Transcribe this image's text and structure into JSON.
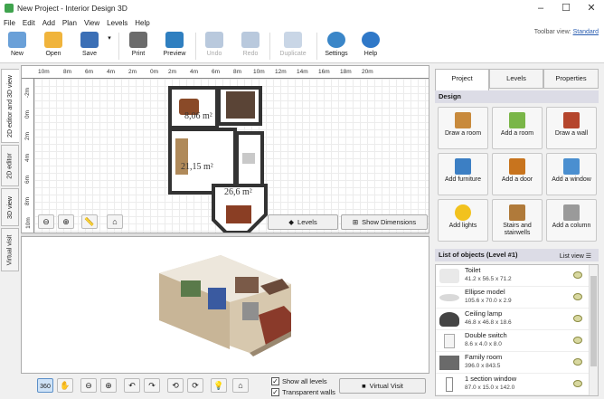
{
  "window": {
    "title": "New Project - Interior Design 3D",
    "minimize": "–",
    "maximize": "☐",
    "close": "✕"
  },
  "menu": [
    "File",
    "Edit",
    "Add",
    "Plan",
    "View",
    "Levels",
    "Help"
  ],
  "toolbar": {
    "buttons": [
      {
        "label": "New",
        "icon": "new-document-icon",
        "color": "#6aa0d8"
      },
      {
        "label": "Open",
        "icon": "open-folder-icon",
        "color": "#f0b43c"
      },
      {
        "label": "Save",
        "icon": "floppy-disk-icon",
        "color": "#3b6fb6"
      },
      {
        "label": "Print",
        "icon": "printer-icon",
        "color": "#6b6b6b"
      },
      {
        "label": "Preview",
        "icon": "monitor-icon",
        "color": "#2f7fc0"
      },
      {
        "label": "Undo",
        "icon": "undo-icon",
        "color": "#b9c9dd"
      },
      {
        "label": "Redo",
        "icon": "redo-icon",
        "color": "#b9c9dd"
      },
      {
        "label": "Duplicate",
        "icon": "duplicate-icon",
        "color": "#c9d6e6"
      },
      {
        "label": "Settings",
        "icon": "gear-icon",
        "color": "#3a86c8"
      },
      {
        "label": "Help",
        "icon": "help-icon",
        "color": "#2f78c8"
      }
    ],
    "view_label": "Toolbar view:",
    "view_value": "Standard"
  },
  "side_tabs": [
    "2D editor and 3D view",
    "2D editor",
    "3D view",
    "Virtual visit"
  ],
  "ruler": {
    "h": [
      "10m",
      "8m",
      "6m",
      "4m",
      "2m",
      "0m",
      "2m",
      "4m",
      "6m",
      "8m",
      "10m",
      "12m",
      "14m",
      "16m",
      "18m",
      "20m"
    ],
    "v": [
      "-2m",
      "0m",
      "2m",
      "4m",
      "6m",
      "8m",
      "10m"
    ]
  },
  "plan": {
    "rooms": [
      {
        "label": "8,06 m²"
      },
      {
        "label": "21,15 m²"
      },
      {
        "label": "26,6 m²"
      }
    ]
  },
  "plan_buttons": {
    "levels": "Levels",
    "show_dimensions": "Show Dimensions"
  },
  "bottom": {
    "show_all_levels": "Show all levels",
    "transparent_walls": "Transparent walls",
    "virtual_visit": "Virtual Visit"
  },
  "right_tabs": [
    "Project",
    "Levels",
    "Properties"
  ],
  "design": {
    "title": "Design",
    "buttons": [
      {
        "label": "Draw a room",
        "icon": "draw-room-icon",
        "color": "#c88a3c"
      },
      {
        "label": "Add a room",
        "icon": "add-room-icon",
        "color": "#7ab648"
      },
      {
        "label": "Draw a wall",
        "icon": "brick-wall-icon",
        "color": "#b5452c"
      },
      {
        "label": "Add furniture",
        "icon": "armchair-icon",
        "color": "#3c7fc4"
      },
      {
        "label": "Add a door",
        "icon": "door-icon",
        "color": "#c8741e"
      },
      {
        "label": "Add a window",
        "icon": "window-icon",
        "color": "#4a8fd0"
      },
      {
        "label": "Add lights",
        "icon": "light-bulb-icon",
        "color": "#f2c21e"
      },
      {
        "label": "Stairs and stairwells",
        "icon": "stairs-icon",
        "color": "#b07a3a"
      },
      {
        "label": "Add a column",
        "icon": "column-icon",
        "color": "#9a9a9a"
      }
    ]
  },
  "objects": {
    "title": "List of objects (Level #1)",
    "list_view": "List view",
    "items": [
      {
        "name": "Toilet",
        "dims": "41.2 x 56.5 x 71.2",
        "icon": "toilet-icon"
      },
      {
        "name": "Ellipse model",
        "dims": "105.6 x 70.0 x 2.9",
        "icon": "ellipse-icon"
      },
      {
        "name": "Ceiling lamp",
        "dims": "46.8 x 46.8 x 18.6",
        "icon": "ceiling-lamp-icon"
      },
      {
        "name": "Double switch",
        "dims": "8.6 x 4.0 x 8.0",
        "icon": "switch-icon"
      },
      {
        "name": "Family room",
        "dims": "396.0 x 843.5",
        "icon": "room-icon"
      },
      {
        "name": "1 section window",
        "dims": "87.0 x 15.0 x 142.0",
        "icon": "window-icon"
      }
    ]
  }
}
